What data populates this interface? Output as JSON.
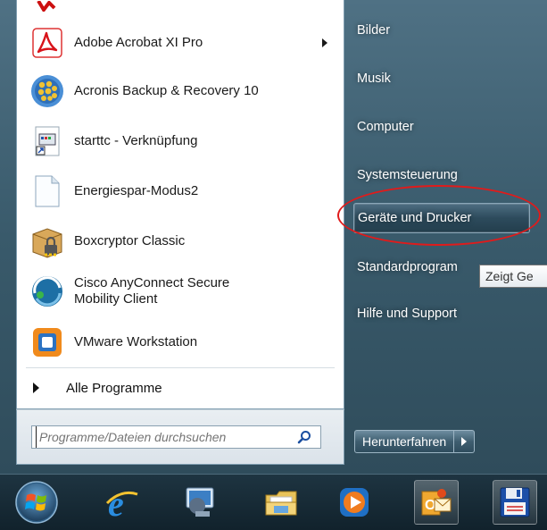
{
  "programs": [
    {
      "label": "Adobe Acrobat XI Pro",
      "icon": "acrobat-icon",
      "has_submenu": true
    },
    {
      "label": "Acronis Backup & Recovery 10",
      "icon": "acronis-icon"
    },
    {
      "label": "starttc - Verknüpfung",
      "icon": "shortcut-icon"
    },
    {
      "label": "Energiespar-Modus2",
      "icon": "document-icon"
    },
    {
      "label": "Boxcryptor Classic",
      "icon": "boxcryptor-icon"
    },
    {
      "label_line1": "Cisco AnyConnect Secure",
      "label_line2": "Mobility Client",
      "icon": "cisco-anyconnect-icon"
    },
    {
      "label": "VMware Workstation",
      "icon": "vmware-icon"
    }
  ],
  "all_programs_label": "Alle Programme",
  "search": {
    "placeholder": "Programme/Dateien durchsuchen"
  },
  "right_items": [
    {
      "label": "Bilder"
    },
    {
      "label": "Musik"
    },
    {
      "label": "Computer"
    },
    {
      "label": "Systemsteuerung"
    },
    {
      "label": "Geräte und Drucker",
      "highlighted": true
    },
    {
      "label": "Standardprogram"
    },
    {
      "label": "Hilfe und Support"
    }
  ],
  "tooltip": "Zeigt Ge",
  "shutdown_label": "Herunterfahren",
  "annotation_color": "#e01b1b",
  "taskbar_icons": [
    "windows-start-icon",
    "internet-explorer-icon",
    "remote-desktop-icon",
    "file-explorer-icon",
    "media-player-icon",
    "outlook-icon",
    "save-disk-icon"
  ]
}
